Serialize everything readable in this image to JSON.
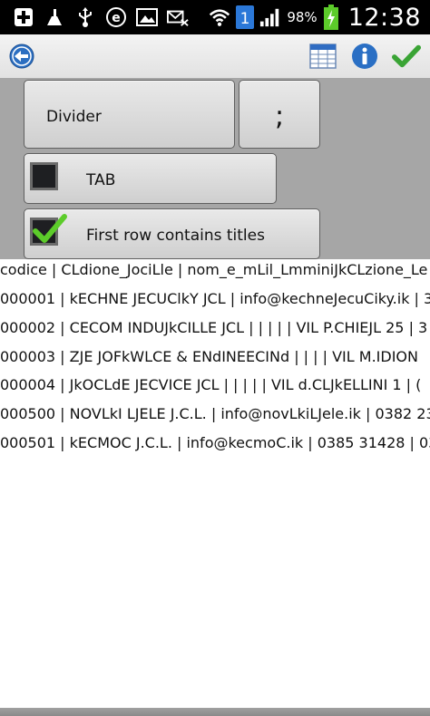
{
  "status_bar": {
    "battery_percent": "98%",
    "time": "12:38",
    "notification_badge": "1",
    "icons": [
      "add-icon",
      "broom-icon",
      "usb-icon",
      "e-icon",
      "image-icon",
      "mail-muted-icon",
      "wifi-icon",
      "notification-icon",
      "signal-icon",
      "battery-charging-icon"
    ]
  },
  "action_bar": {
    "icons": [
      "back-icon",
      "table-icon",
      "info-icon",
      "checkmark-icon"
    ],
    "colors": {
      "back": "#2c6fc1",
      "info": "#2a6fc4",
      "check": "#3aa435"
    }
  },
  "settings": {
    "divider_label": "Divider",
    "divider_value": ";",
    "tab_label": "TAB",
    "tab_checked": false,
    "titles_label": "First row contains titles",
    "titles_checked": true,
    "check_color": "#5ccc2a"
  },
  "preview": {
    "rows": [
      "codice | CLdione_JociLle | nom_e_mLil_LmminiJkCLzione_Le",
      "000001 | kECHNE JECUClkY JCL | info@kechneJecuCiky.ik | 3",
      "000002 | CECOM INDUJkCILLE JCL | | | | | VIL P.CHIEJL 25 | 3",
      "000003 | ZJE JOFkWLCE & ENdINEECINd | | | | VIL M.IDION",
      "000004 | JkOCLdE JECVICE JCL | | | | | VIL d.CLJkELLINI 1 | (",
      "000500 | NOVLkI LJELE J.C.L. | info@novLkiLJele.ik | 0382 23",
      "000501 | kECMOC J.C.L. | info@kecmoC.ik | 0385 31428 | 038"
    ]
  }
}
